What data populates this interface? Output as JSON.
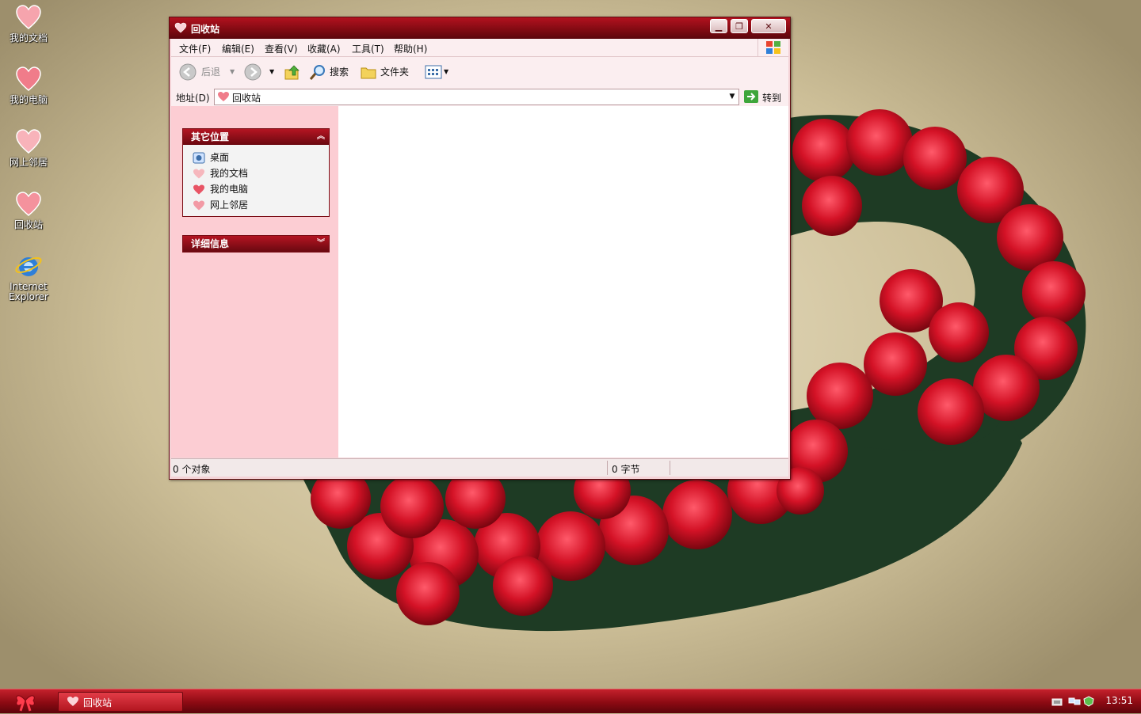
{
  "desktop": {
    "icons": [
      {
        "label": "我的文档"
      },
      {
        "label": "我的电脑"
      },
      {
        "label": "网上邻居"
      },
      {
        "label": "回收站"
      },
      {
        "label": "Internet Explorer"
      }
    ]
  },
  "window": {
    "title": "回收站",
    "menu": [
      "文件(F)",
      "编辑(E)",
      "查看(V)",
      "收藏(A)",
      "工具(T)",
      "帮助(H)"
    ],
    "toolbar": {
      "back_label": "后退",
      "search_label": "搜索",
      "folders_label": "文件夹"
    },
    "address": {
      "label": "地址(D)",
      "value": "回收站",
      "go_label": "转到"
    },
    "panels": {
      "other_places": {
        "title": "其它位置",
        "items": [
          "桌面",
          "我的文档",
          "我的电脑",
          "网上邻居"
        ]
      },
      "details": {
        "title": "详细信息"
      }
    },
    "status": {
      "objects": "0 个对象",
      "bytes": "0 字节"
    }
  },
  "taskbar": {
    "active_task": "回收站",
    "clock": "13:51"
  },
  "colors": {
    "title_red": "#8f0b14",
    "left_pane_pink": "#fccdd3",
    "taskbar_red": "#a10f18"
  }
}
